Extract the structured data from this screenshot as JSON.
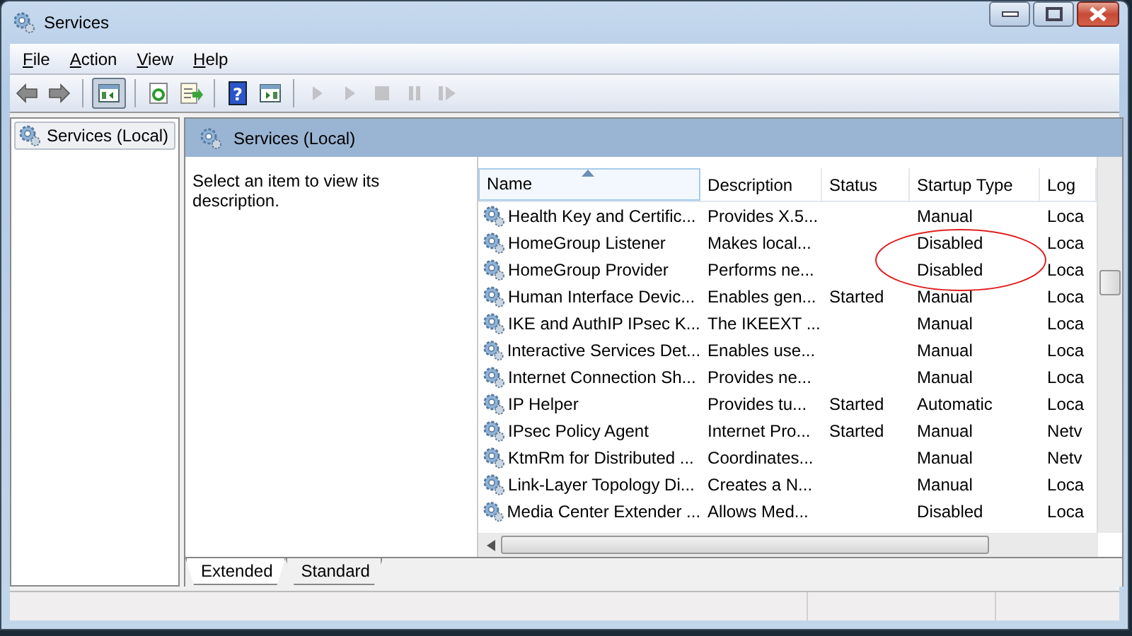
{
  "window": {
    "title": "Services"
  },
  "menu": [
    {
      "label": "File"
    },
    {
      "label": "Action"
    },
    {
      "label": "View"
    },
    {
      "label": "Help"
    }
  ],
  "toolbar": [
    {
      "buttons": [
        {
          "kind": "back",
          "disabled": false,
          "pressed": false
        },
        {
          "kind": "forward",
          "disabled": false,
          "pressed": false
        }
      ]
    },
    {
      "buttons": [
        {
          "kind": "console-tree",
          "disabled": false,
          "pressed": true
        }
      ]
    },
    {
      "buttons": [
        {
          "kind": "refresh",
          "disabled": false,
          "pressed": false
        },
        {
          "kind": "export",
          "disabled": false,
          "pressed": false
        }
      ]
    },
    {
      "buttons": [
        {
          "kind": "help",
          "glyph": "?",
          "disabled": false,
          "pressed": false
        },
        {
          "kind": "action-pane",
          "disabled": false,
          "pressed": false
        }
      ]
    },
    {
      "buttons": [
        {
          "kind": "start",
          "disabled": true,
          "pressed": false
        },
        {
          "kind": "start",
          "disabled": true,
          "pressed": false
        },
        {
          "kind": "stop",
          "disabled": true,
          "pressed": false
        },
        {
          "kind": "pause",
          "disabled": true,
          "pressed": false
        },
        {
          "kind": "resume",
          "disabled": true,
          "pressed": false
        }
      ]
    }
  ],
  "tree": {
    "items": [
      {
        "label": "Services (Local)",
        "selected": true
      }
    ]
  },
  "pane": {
    "title": "Services (Local)",
    "description": "Select an item to view its description."
  },
  "table": {
    "columns": [
      {
        "label": "Name",
        "sorted": true
      },
      {
        "label": "Description",
        "sorted": false
      },
      {
        "label": "Status",
        "sorted": false
      },
      {
        "label": "Startup Type",
        "sorted": false
      },
      {
        "label": "Log",
        "sorted": false
      }
    ],
    "rows": [
      {
        "name": "Health Key and Certific...",
        "description": "Provides X.5...",
        "status": "",
        "startup_type": "Manual",
        "log_on_as": "Loca"
      },
      {
        "name": "HomeGroup Listener",
        "description": "Makes local...",
        "status": "",
        "startup_type": "Disabled",
        "log_on_as": "Loca"
      },
      {
        "name": "HomeGroup Provider",
        "description": "Performs ne...",
        "status": "",
        "startup_type": "Disabled",
        "log_on_as": "Loca"
      },
      {
        "name": "Human Interface Devic...",
        "description": "Enables gen...",
        "status": "Started",
        "startup_type": "Manual",
        "log_on_as": "Loca"
      },
      {
        "name": "IKE and AuthIP IPsec K...",
        "description": "The IKEEXT ...",
        "status": "",
        "startup_type": "Manual",
        "log_on_as": "Loca"
      },
      {
        "name": "Interactive Services Det...",
        "description": "Enables use...",
        "status": "",
        "startup_type": "Manual",
        "log_on_as": "Loca"
      },
      {
        "name": "Internet Connection Sh...",
        "description": "Provides ne...",
        "status": "",
        "startup_type": "Manual",
        "log_on_as": "Loca"
      },
      {
        "name": "IP Helper",
        "description": "Provides tu...",
        "status": "Started",
        "startup_type": "Automatic",
        "log_on_as": "Loca"
      },
      {
        "name": "IPsec Policy Agent",
        "description": "Internet Pro...",
        "status": "Started",
        "startup_type": "Manual",
        "log_on_as": "Netv"
      },
      {
        "name": "KtmRm for Distributed ...",
        "description": "Coordinates...",
        "status": "",
        "startup_type": "Manual",
        "log_on_as": "Netv"
      },
      {
        "name": "Link-Layer Topology Di...",
        "description": "Creates a N...",
        "status": "",
        "startup_type": "Manual",
        "log_on_as": "Loca"
      },
      {
        "name": "Media Center Extender ...",
        "description": "Allows Med...",
        "status": "",
        "startup_type": "Disabled",
        "log_on_as": "Loca"
      }
    ]
  },
  "view_tabs": [
    {
      "label": "Extended",
      "selected": true
    },
    {
      "label": "Standard",
      "selected": false
    }
  ]
}
